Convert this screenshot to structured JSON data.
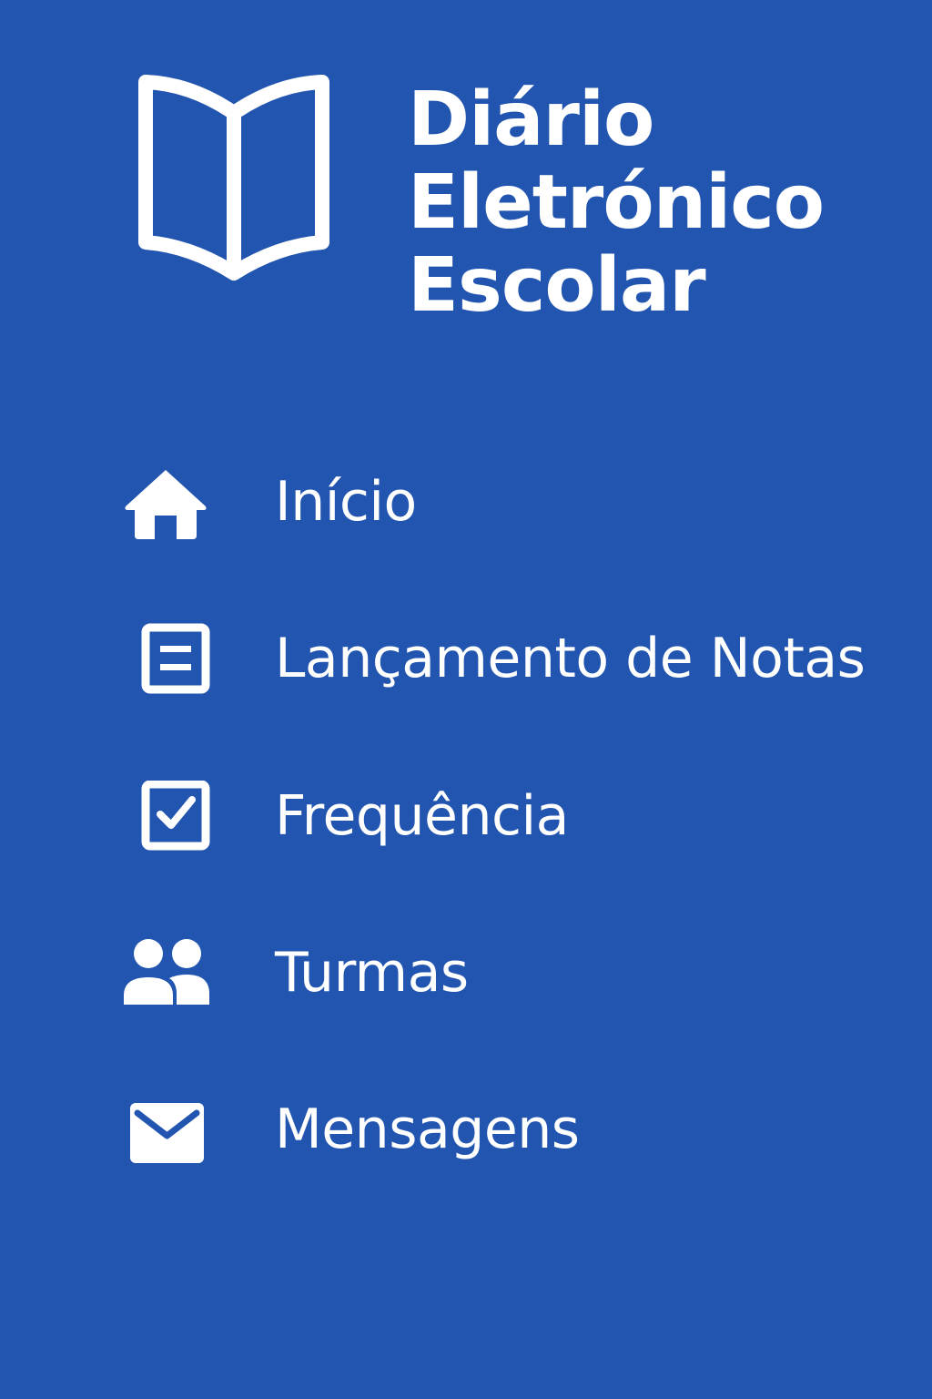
{
  "app": {
    "title_lines": [
      "Diário",
      "Eletrónico",
      "Escolar"
    ],
    "logo_icon": "open-book-icon"
  },
  "colors": {
    "background": "#2255B0",
    "foreground": "#FFFFFF"
  },
  "menu": {
    "items": [
      {
        "label": "Início",
        "icon": "home-icon"
      },
      {
        "label": "Lançamento de Notas",
        "icon": "document-icon"
      },
      {
        "label": "Frequência",
        "icon": "checkbox-icon"
      },
      {
        "label": "Turmas",
        "icon": "users-icon"
      },
      {
        "label": "Mensagens",
        "icon": "mail-icon"
      }
    ]
  }
}
